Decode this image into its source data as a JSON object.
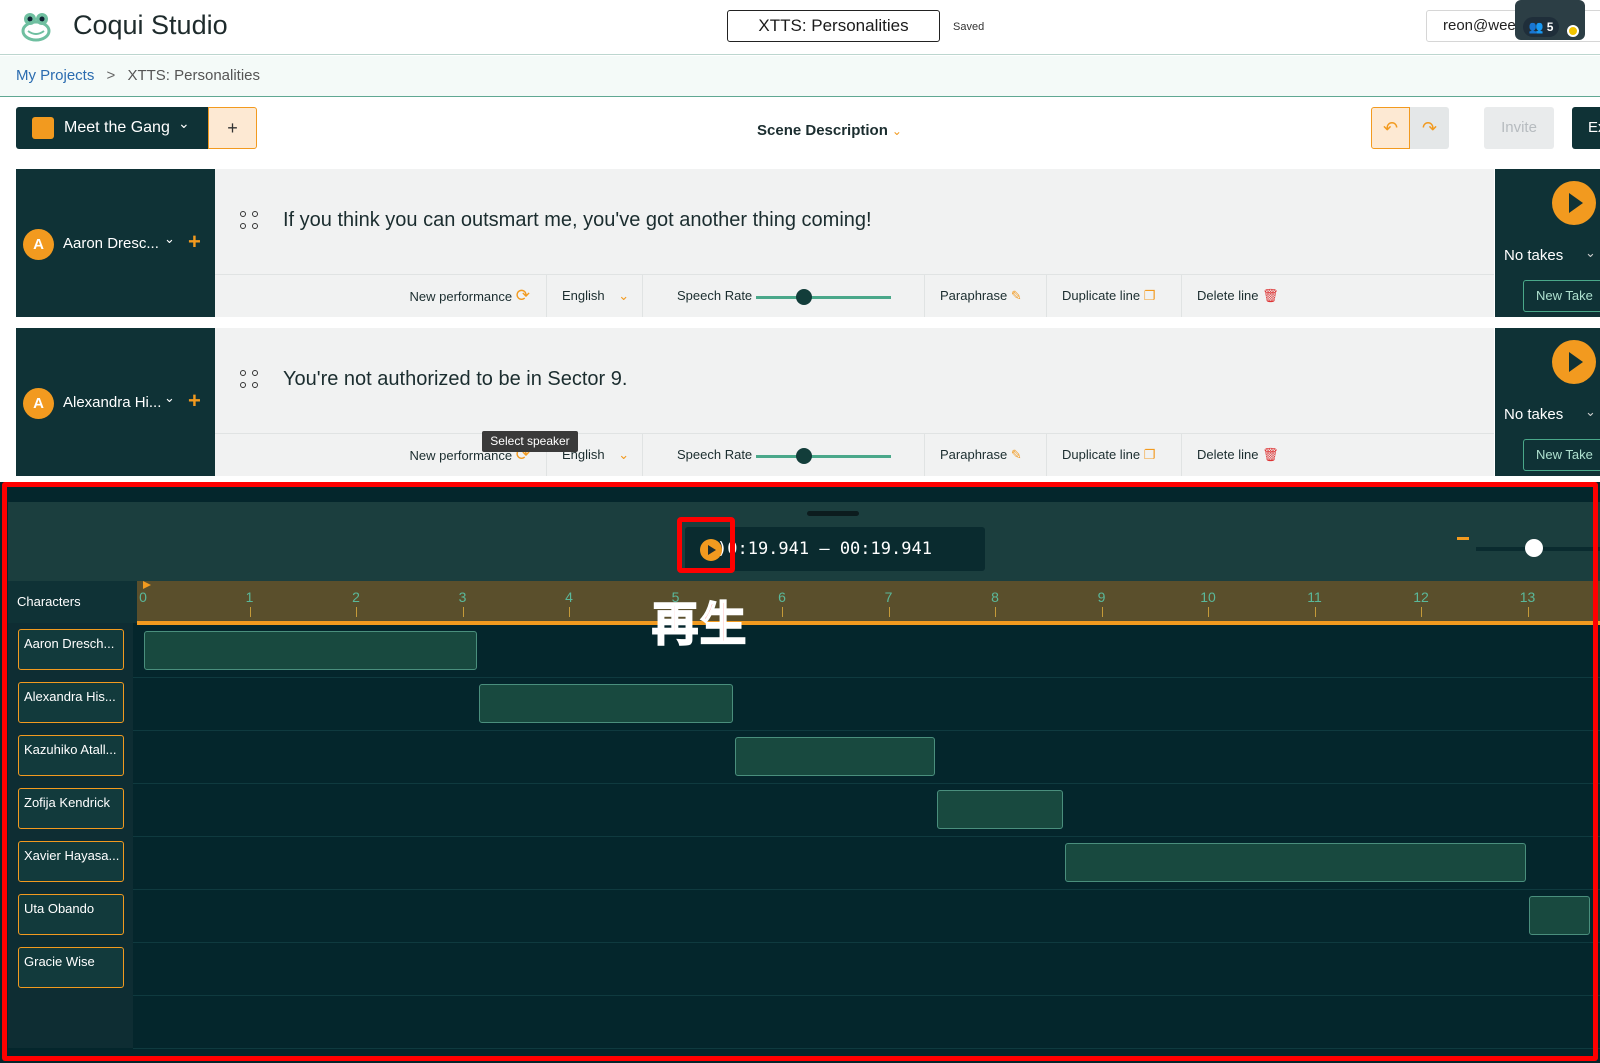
{
  "app": {
    "title": "Coqui Studio",
    "project_name": "XTTS: Personalities",
    "save_status": "Saved",
    "user": "reon@weewe",
    "collaborator_count": "5"
  },
  "breadcrumb": {
    "root": "My Projects",
    "separator": ">",
    "current": "XTTS: Personalities"
  },
  "toolbar": {
    "scene_name": "Meet the Gang",
    "add_label": "+",
    "scene_description": "Scene Description",
    "invite": "Invite",
    "export": "Ex"
  },
  "lines": [
    {
      "speaker": "Aaron Dresc...",
      "initial": "A",
      "text": "If you think you can outsmart me, you've got another thing coming!",
      "takes": "No takes"
    },
    {
      "speaker": "Alexandra Hi...",
      "initial": "A",
      "text": "You're not authorized to be in Sector 9.",
      "takes": "No takes"
    }
  ],
  "line_controls": {
    "new_performance": "New performance",
    "language": "English",
    "speech_rate": "Speech Rate",
    "speech_rate_value": 0.35,
    "paraphrase": "Paraphrase",
    "duplicate": "Duplicate line",
    "delete": "Delete line",
    "new_take": "New Take"
  },
  "tooltip": "Select speaker",
  "timeline": {
    "time_range": "00:19.941 – 00:19.941",
    "time_visible": ")0:19.941 – 00:19.941",
    "characters_label": "Characters",
    "ticks": [
      "0",
      "1",
      "2",
      "3",
      "4",
      "5",
      "6",
      "7",
      "8",
      "9",
      "10",
      "11",
      "12",
      "13"
    ],
    "characters": [
      "Aaron Dresch...",
      "Alexandra His...",
      "Kazuhiko Atall...",
      "Zofija Kendrick",
      "Xavier Hayasa...",
      "Uta Obando",
      "Gracie Wise"
    ],
    "clips": [
      {
        "character": "Aaron Dresch...",
        "start": 0.0,
        "end": 3.15
      },
      {
        "character": "Alexandra His...",
        "start": 3.15,
        "end": 5.55
      },
      {
        "character": "Kazuhiko Atall...",
        "start": 5.55,
        "end": 7.45
      },
      {
        "character": "Zofija Kendrick",
        "start": 7.45,
        "end": 8.65
      },
      {
        "character": "Xavier Hayasa...",
        "start": 8.65,
        "end": 13.0
      },
      {
        "character": "Uta Obando",
        "start": 13.0,
        "end": 13.6
      }
    ]
  },
  "annotation": "再生",
  "colors": {
    "accent": "#f29a1f",
    "dark": "#0f3236",
    "timeline_bg": "#04262c",
    "highlight": "#ff0000"
  }
}
